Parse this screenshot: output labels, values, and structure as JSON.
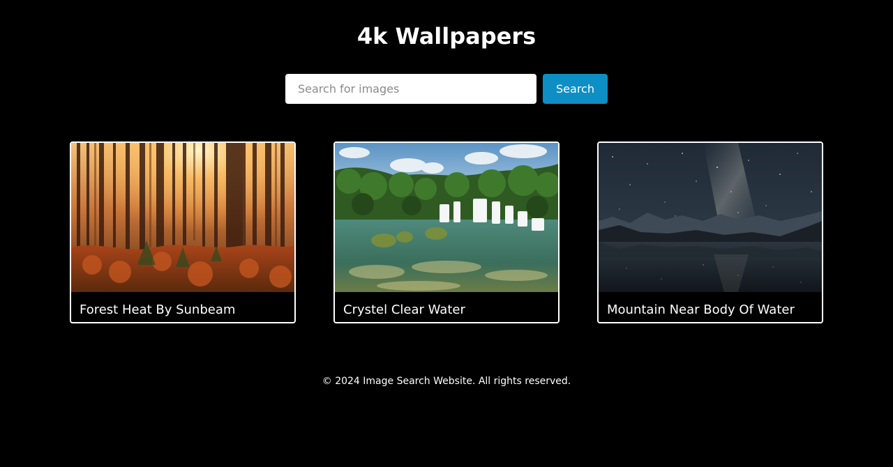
{
  "header": {
    "title": "4k Wallpapers"
  },
  "search": {
    "placeholder": "Search for images",
    "value": "",
    "button_label": "Search"
  },
  "results": [
    {
      "caption": "Forest Heat By Sunbeam"
    },
    {
      "caption": "Crystel Clear Water"
    },
    {
      "caption": "Mountain Near Body Of Water"
    }
  ],
  "footer": {
    "text": "© 2024 Image Search Website. All rights reserved."
  },
  "colors": {
    "background": "#000000",
    "accent": "#0d8ec4",
    "text": "#ffffff"
  }
}
